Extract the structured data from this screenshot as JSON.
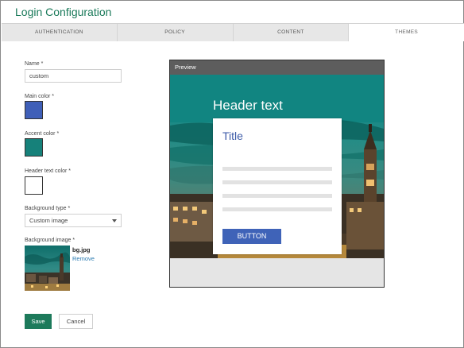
{
  "app": {
    "title": "Login Configuration"
  },
  "tabs": [
    {
      "label": "AUTHENTICATION",
      "active": false
    },
    {
      "label": "POLICY",
      "active": false
    },
    {
      "label": "CONTENT",
      "active": false
    },
    {
      "label": "THEMES",
      "active": true
    }
  ],
  "form": {
    "name_label": "Name *",
    "name_value": "custom",
    "main_color_label": "Main color *",
    "main_color": "#3f5fb8",
    "accent_color_label": "Accent color *",
    "accent_color": "#16817a",
    "header_text_color_label": "Header text color *",
    "header_text_color": "#ffffff",
    "background_type_label": "Background type *",
    "background_type_value": "Custom image",
    "background_image_label": "Background image *",
    "background_image_filename": "bg.jpg",
    "remove_label": "Remove"
  },
  "actions": {
    "save_label": "Save",
    "cancel_label": "Cancel"
  },
  "preview": {
    "bar_label": "Preview",
    "header_text": "Header text",
    "card_title": "Title",
    "button_label": "BUTTON",
    "accent_color": "#16817a",
    "main_color": "#3f63b8"
  },
  "colors": {
    "brand_green": "#1d7a5b",
    "link_blue": "#2a7ab0"
  }
}
